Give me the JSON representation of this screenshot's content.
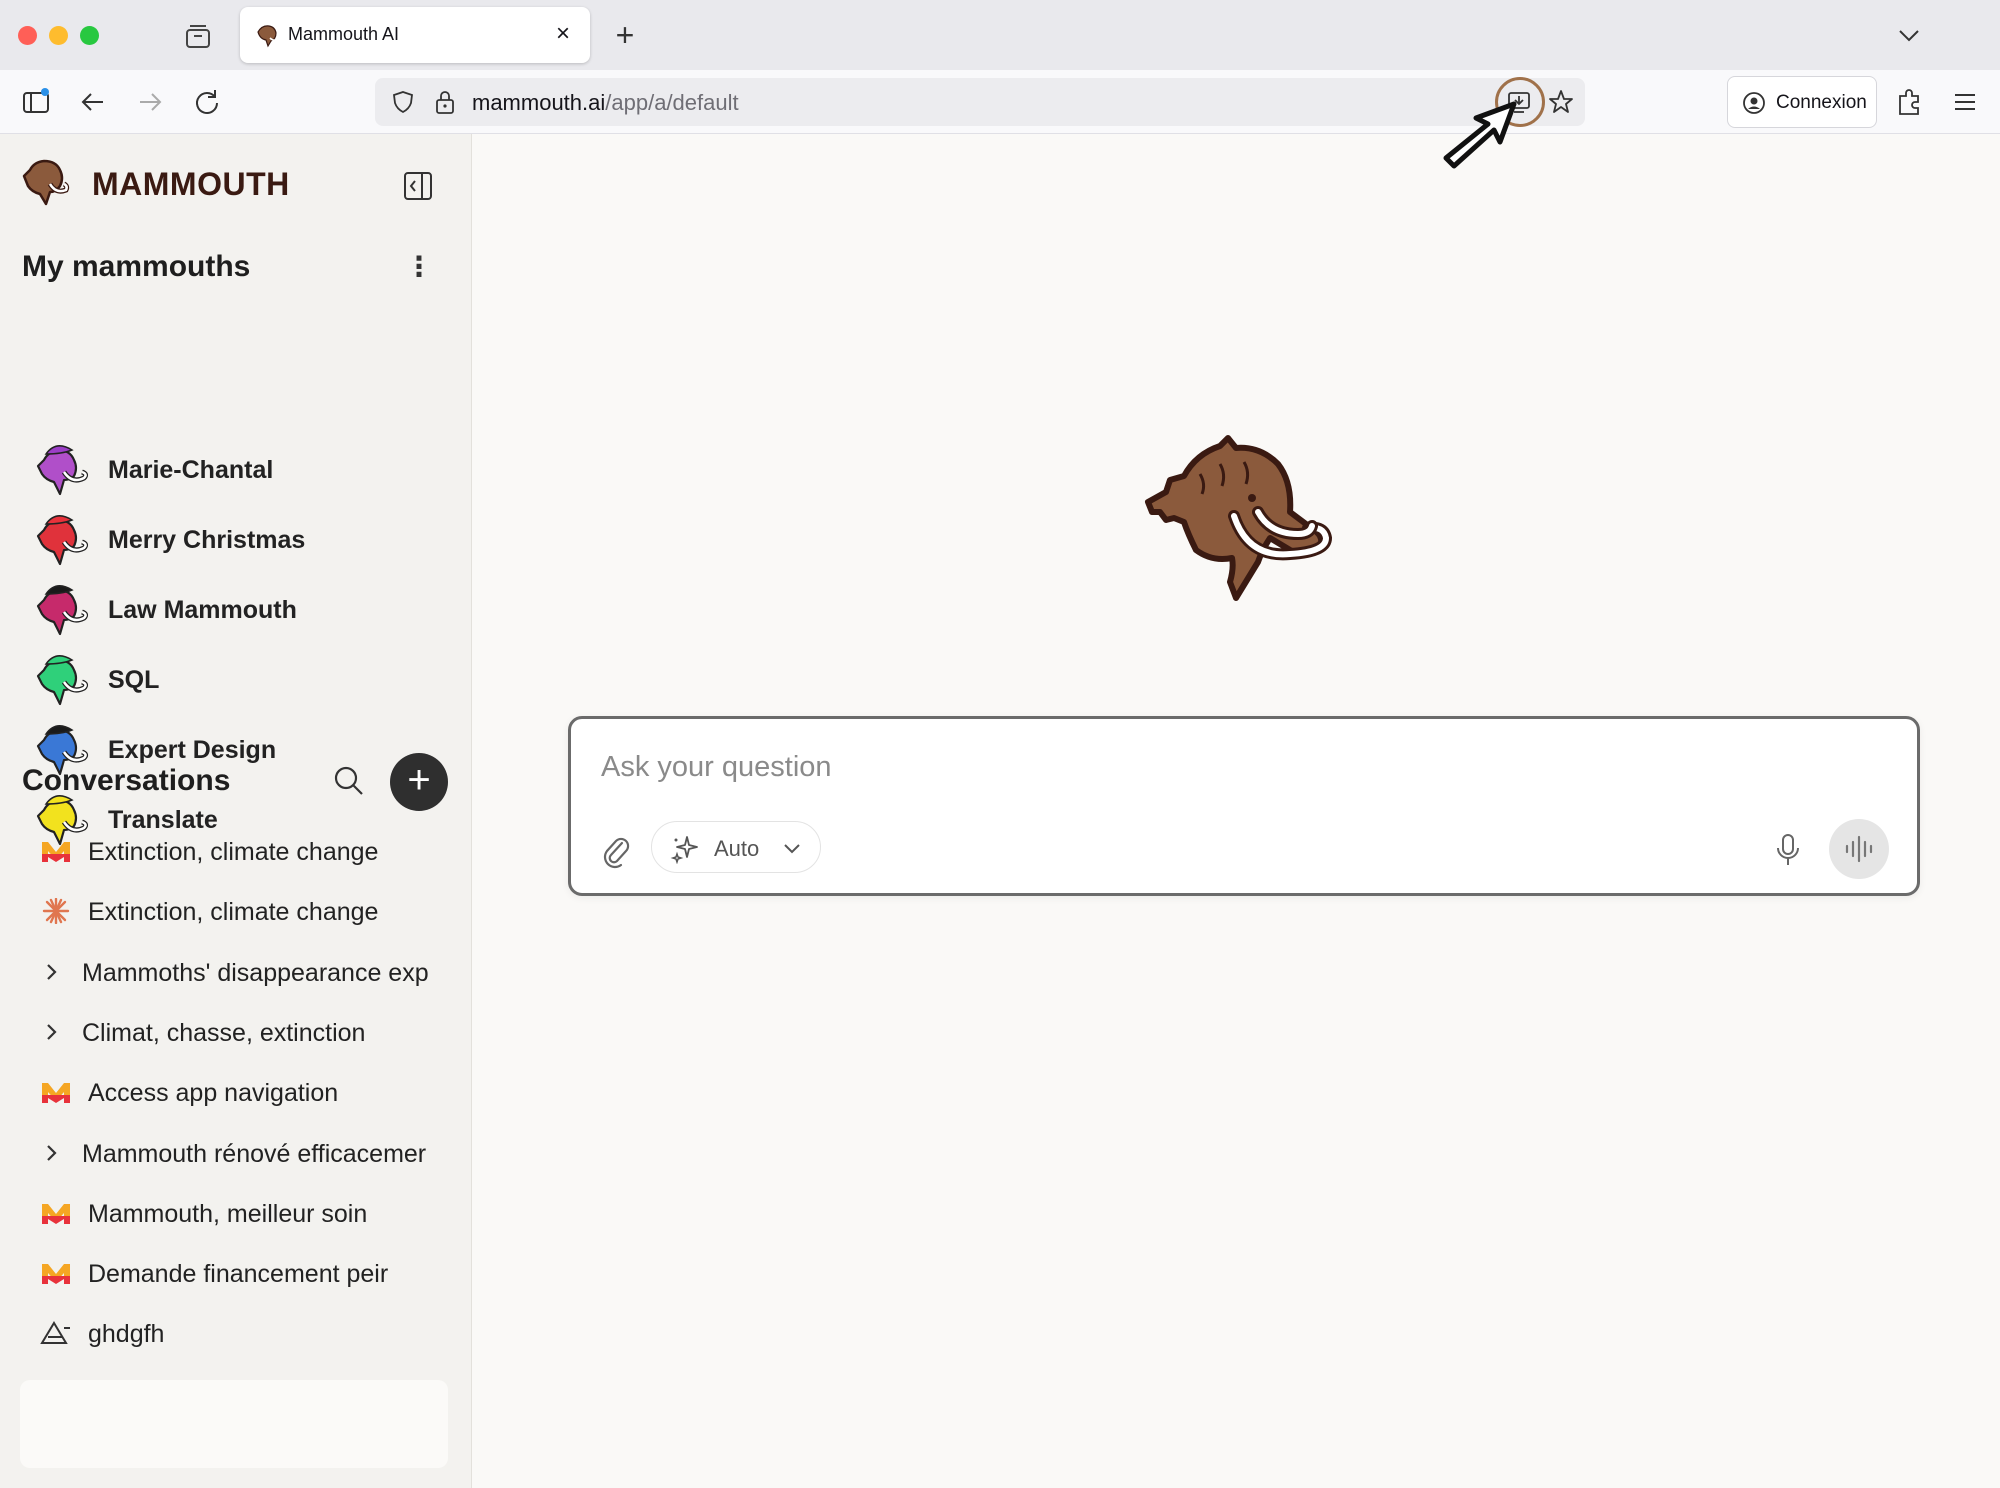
{
  "browser": {
    "tab_title": "Mammouth AI",
    "url_host": "mammouth.ai",
    "url_path": "/app/a/default",
    "connexion_label": "Connexion"
  },
  "sidebar": {
    "brand": "MAMMOUTH",
    "mammoths_title": "My mammouths",
    "mammoths": [
      {
        "label": "Marie-Chantal",
        "color": "#b04fc9",
        "hat": "#9c3ec7"
      },
      {
        "label": "Merry Christmas",
        "color": "#e0323b",
        "hat": "#e8323b"
      },
      {
        "label": "Law Mammouth",
        "color": "#c62a6b",
        "hat": "#1a1a1a"
      },
      {
        "label": "SQL",
        "color": "#2fd07a",
        "hat": "#2fd07a"
      },
      {
        "label": "Expert Design",
        "color": "#3a78d6",
        "hat": "#1a1a1a"
      },
      {
        "label": "Translate",
        "color": "#f2e21e",
        "hat": "#f2e21e"
      }
    ],
    "conversations_title": "Conversations",
    "conversations": [
      {
        "label": "Extinction, climate change",
        "icon": "mammouth-m-icon",
        "group": false
      },
      {
        "label": "Extinction, climate change",
        "icon": "claude-spark-icon",
        "group": false
      },
      {
        "label": "Mammoths' disappearance exp",
        "icon": "chevron-right-icon",
        "group": true
      },
      {
        "label": "Climat, chasse, extinction",
        "icon": "chevron-right-icon",
        "group": true
      },
      {
        "label": "Access app navigation",
        "icon": "mammouth-m-icon",
        "group": false
      },
      {
        "label": "Mammouth rénové efficacemer",
        "icon": "chevron-right-icon",
        "group": true
      },
      {
        "label": "Mammouth, meilleur soin",
        "icon": "mammouth-m-icon",
        "group": false
      },
      {
        "label": "Demande financement peir",
        "icon": "mammouth-m-icon",
        "group": false
      },
      {
        "label": "ghdgfh",
        "icon": "perplexity-icon",
        "group": false
      }
    ]
  },
  "composer": {
    "placeholder": "Ask your question",
    "model_label": "Auto"
  },
  "colors": {
    "brand_brown": "#a0714a",
    "brand_dark": "#3a1a12",
    "accent_dark": "#2f2f2f"
  }
}
